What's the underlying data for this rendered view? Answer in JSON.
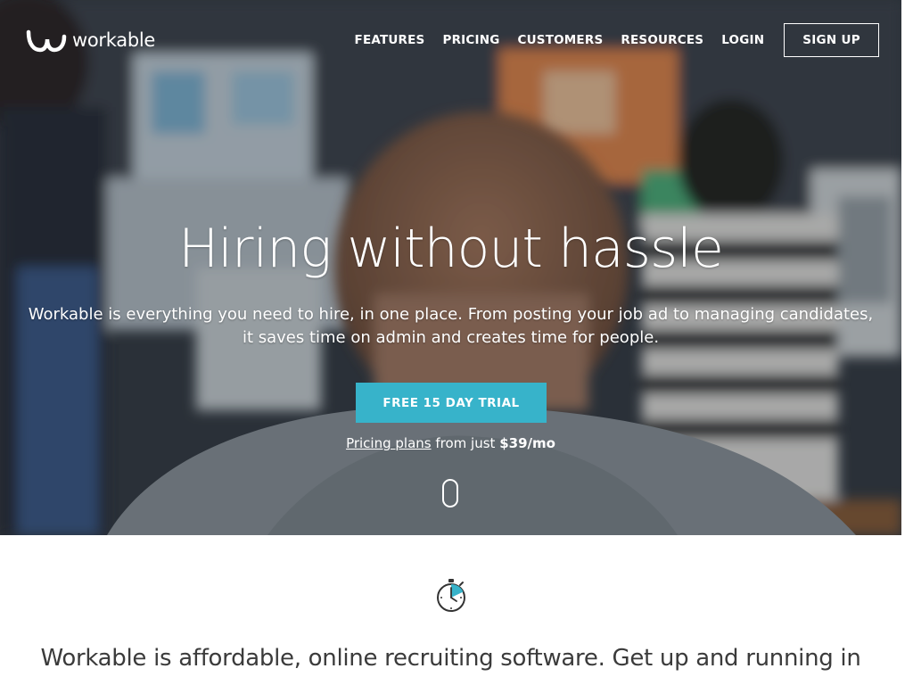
{
  "brand": {
    "name": "workable",
    "accent": "#37b3ca"
  },
  "nav": {
    "items": [
      "FEATURES",
      "PRICING",
      "CUSTOMERS",
      "RESOURCES",
      "LOGIN"
    ],
    "signup_label": "SIGN UP"
  },
  "hero": {
    "headline": "Hiring without hassle",
    "subhead_line1": "Workable is everything you need to hire, in one place. From posting your job ad to managing candidates,",
    "subhead_line2": "it saves time on admin and creates time for people.",
    "cta_label": "FREE 15 DAY TRIAL",
    "pricing_link": "Pricing plans",
    "pricing_text": "from just",
    "pricing_price": "$39/mo"
  },
  "section": {
    "icon": "stopwatch-icon",
    "tagline_line1": "Workable is affordable, online recruiting software. Get up and running in"
  }
}
